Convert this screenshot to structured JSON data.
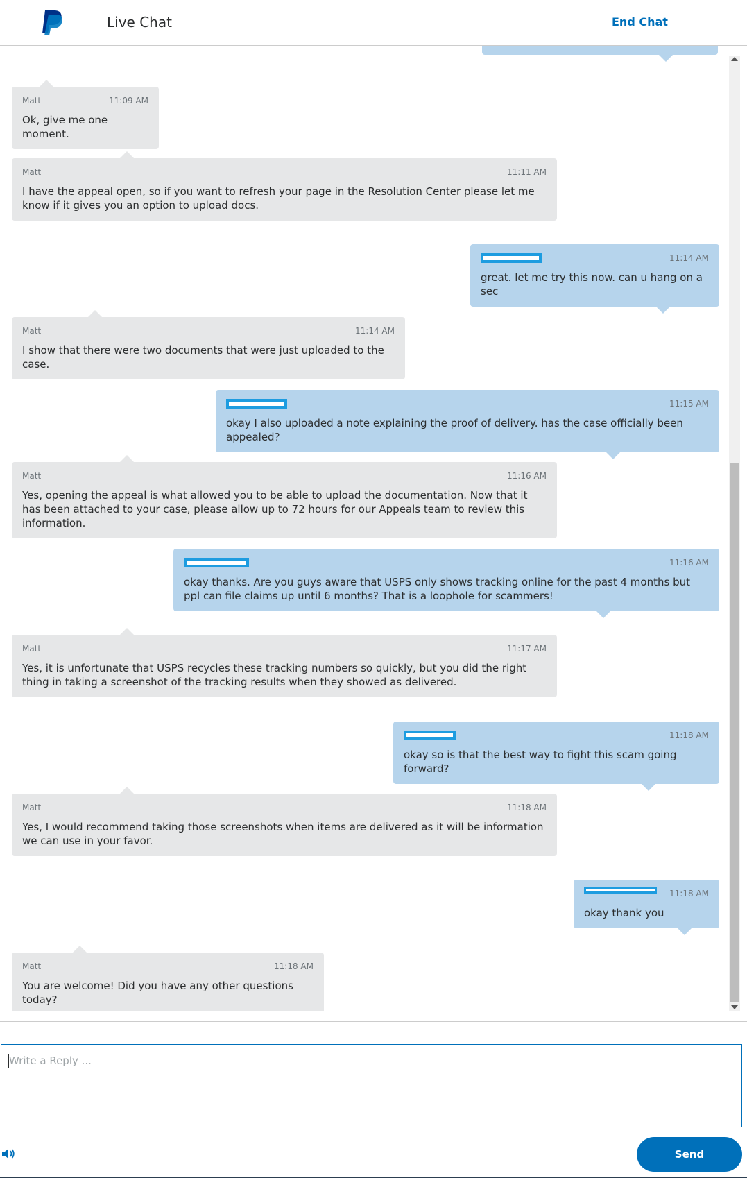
{
  "header": {
    "title": "Live Chat",
    "end_chat_label": "End Chat"
  },
  "messages": [
    {
      "from": "agent",
      "sender": "Matt",
      "time": "11:09 AM",
      "text": "Ok, give me one moment."
    },
    {
      "from": "agent",
      "sender": "Matt",
      "time": "11:11 AM",
      "text": "I have the appeal open, so if you want to refresh your page in the Resolution Center please let me know if it gives you an option to upload docs."
    },
    {
      "from": "user",
      "sender": "",
      "time": "11:14 AM",
      "text": "great. let me try this now. can u hang on a sec"
    },
    {
      "from": "agent",
      "sender": "Matt",
      "time": "11:14 AM",
      "text": "I show that there were two documents that were just uploaded to the case."
    },
    {
      "from": "user",
      "sender": "",
      "time": "11:15 AM",
      "text": "okay I also uploaded a note explaining the proof of delivery. has the case officially been appealed?"
    },
    {
      "from": "agent",
      "sender": "Matt",
      "time": "11:16 AM",
      "text": "Yes, opening the appeal is what allowed you to be able to upload the documentation. Now that it has been attached to your case, please allow up to 72 hours for our Appeals team to review this information."
    },
    {
      "from": "user",
      "sender": "",
      "time": "11:16 AM",
      "text": "okay thanks. Are you guys aware that USPS only shows tracking online for the past 4 months but ppl can file claims up until 6 months? That is a loophole for scammers!"
    },
    {
      "from": "agent",
      "sender": "Matt",
      "time": "11:17 AM",
      "text": "Yes, it is unfortunate that USPS recycles these tracking numbers so quickly, but you did the right thing in taking a screenshot of the tracking results when they showed as delivered."
    },
    {
      "from": "user",
      "sender": "",
      "time": "11:18 AM",
      "text": "okay so is that the best way to fight this scam going forward?"
    },
    {
      "from": "agent",
      "sender": "Matt",
      "time": "11:18 AM",
      "text": "Yes, I would recommend taking those screenshots when items are delivered as it will be information we can use in your favor."
    },
    {
      "from": "user",
      "sender": "",
      "time": "11:18 AM",
      "text": "okay thank you"
    },
    {
      "from": "agent",
      "sender": "Matt",
      "time": "11:18 AM",
      "text": "You are welcome! Did you have any other questions today?"
    }
  ],
  "reply": {
    "placeholder": "Write a Reply ...",
    "value": ""
  },
  "send_label": "Send",
  "icons": {
    "logo": "paypal-logo",
    "speaker": "speaker-icon"
  },
  "colors": {
    "accent": "#0070ba",
    "agent_bubble": "#e6e7e8",
    "user_bubble": "#b6d4ec",
    "redaction": "#1d9ce0"
  }
}
